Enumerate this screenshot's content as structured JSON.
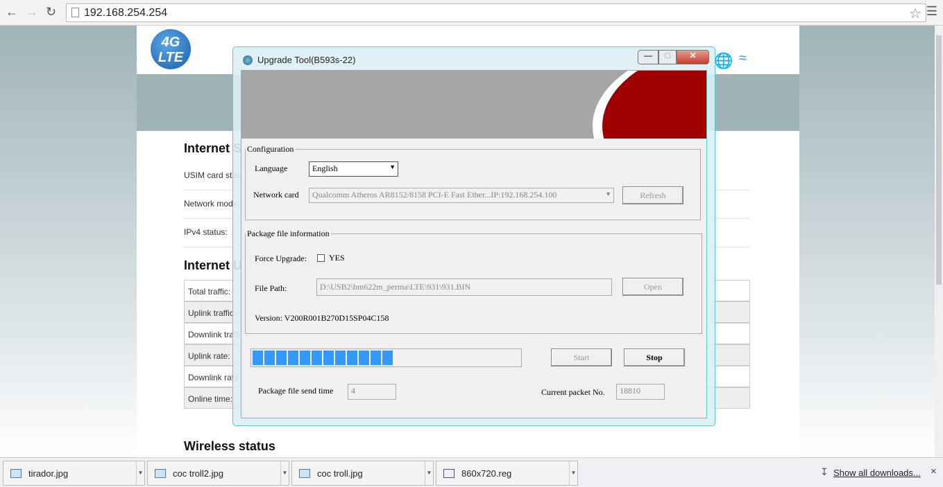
{
  "browser": {
    "url": "192.168.254.254"
  },
  "router_page": {
    "logo_text": "Globe 4G LTE",
    "internet_status_title": "Internet Status",
    "status_rows": [
      "USIM card status:",
      "Network mode:",
      "IPv4 status:"
    ],
    "usage_title": "Internet Usage",
    "usage_rows": [
      "Total traffic:",
      "Uplink traffic:",
      "Downlink traffic:",
      "Uplink rate:",
      "Downlink rate:",
      "Online time:"
    ],
    "wireless_title": "Wireless status"
  },
  "dialog": {
    "title": "Upgrade Tool(B593s-22)",
    "configuration": {
      "legend": "Configuration",
      "language_label": "Language",
      "language_value": "English",
      "network_card_label": "Network card",
      "network_card_value": "Qualcomm Atheros AR8152/8158 PCI-E Fast Ether...IP:192.168.254.100",
      "refresh_label": "Refresh"
    },
    "package": {
      "legend": "Package file information",
      "force_upgrade_label": "Force Upgrade:",
      "force_upgrade_option": "YES",
      "force_upgrade_checked": false,
      "file_path_label": "File Path:",
      "file_path_value": "D:\\USB2\\bm622m_perma\\LTE\\931\\931.BIN",
      "open_label": "Open",
      "version": "Version: V200R001B270D15SP04C158"
    },
    "progress_percent": 49,
    "start_label": "Start",
    "stop_label": "Stop",
    "send_time_label": "Package file send time",
    "send_time_value": "4",
    "packet_label": "Current packet No.",
    "packet_value": "18810",
    "accent_color": "#3399ff"
  },
  "downloads": {
    "items": [
      "tirador.jpg",
      "coc troll2.jpg",
      "coc troll.jpg",
      "860x720.reg"
    ],
    "show_all": "Show all downloads..."
  }
}
